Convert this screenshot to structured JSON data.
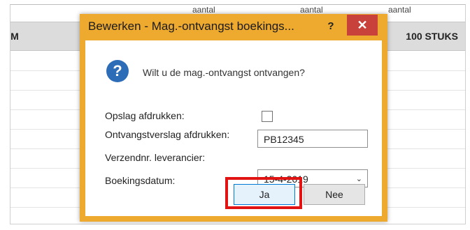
{
  "background": {
    "col_headers": [
      "aantal",
      "aantal",
      "aantal"
    ],
    "row_left": "AM",
    "row_right": "100 STUKS"
  },
  "dialog": {
    "title": "Bewerken - Mag.-ontvangst boekings...",
    "help": "?",
    "close": "✕",
    "question": "Wilt u de mag.-ontvangst ontvangen?",
    "fields": {
      "opslag_label": "Opslag afdrukken:",
      "verslag_label": "Ontvangstverslag afdrukken:",
      "verzend_label": "Verzendnr. leverancier:",
      "verzend_value": "PB12345",
      "datum_label": "Boekingsdatum:",
      "datum_value": "15-4-2019"
    },
    "buttons": {
      "ja": "Ja",
      "nee": "Nee"
    }
  },
  "colors": {
    "title_bg": "#eea92f",
    "close_bg": "#c8413a",
    "highlight": "#e11313"
  }
}
